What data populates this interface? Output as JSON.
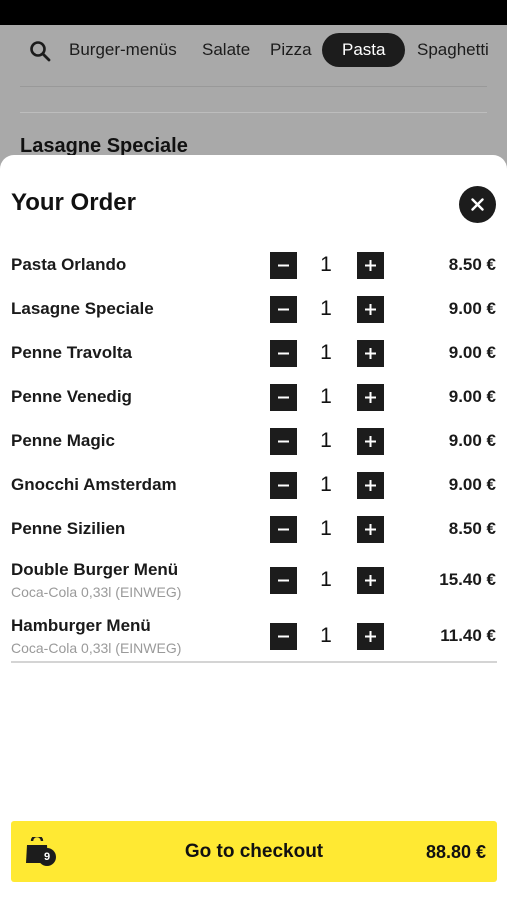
{
  "categories": {
    "items": [
      "Burger-menüs",
      "Salate",
      "Pizza",
      "Pasta",
      "Spaghetti"
    ],
    "active": "Pasta",
    "search_icon": "search-icon"
  },
  "background": {
    "section_heading": "Lasagne Speciale"
  },
  "order_sheet": {
    "title": "Your Order",
    "close_icon": "close-icon",
    "items": [
      {
        "name": "Pasta Orlando",
        "sub": "",
        "qty": "1",
        "price": "8.50 €"
      },
      {
        "name": "Lasagne Speciale",
        "sub": "",
        "qty": "1",
        "price": "9.00 €"
      },
      {
        "name": "Penne Travolta",
        "sub": "",
        "qty": "1",
        "price": "9.00 €"
      },
      {
        "name": "Penne Venedig",
        "sub": "",
        "qty": "1",
        "price": "9.00 €"
      },
      {
        "name": "Penne Magic",
        "sub": "",
        "qty": "1",
        "price": "9.00 €"
      },
      {
        "name": "Gnocchi Amsterdam",
        "sub": "",
        "qty": "1",
        "price": "9.00 €"
      },
      {
        "name": "Penne Sizilien",
        "sub": "",
        "qty": "1",
        "price": "8.50 €"
      },
      {
        "name": "Double Burger Menü",
        "sub": "Coca-Cola 0,33l (EINWEG)",
        "qty": "1",
        "price": "15.40 €"
      },
      {
        "name": "Hamburger Menü",
        "sub": "Coca-Cola 0,33l (EINWEG)",
        "qty": "1",
        "price": "11.40 €"
      }
    ]
  },
  "checkout": {
    "label": "Go to checkout",
    "total": "88.80 €",
    "bag_count": "9",
    "bag_icon": "shopping-bag-icon",
    "accent_color": "#ffe933"
  }
}
